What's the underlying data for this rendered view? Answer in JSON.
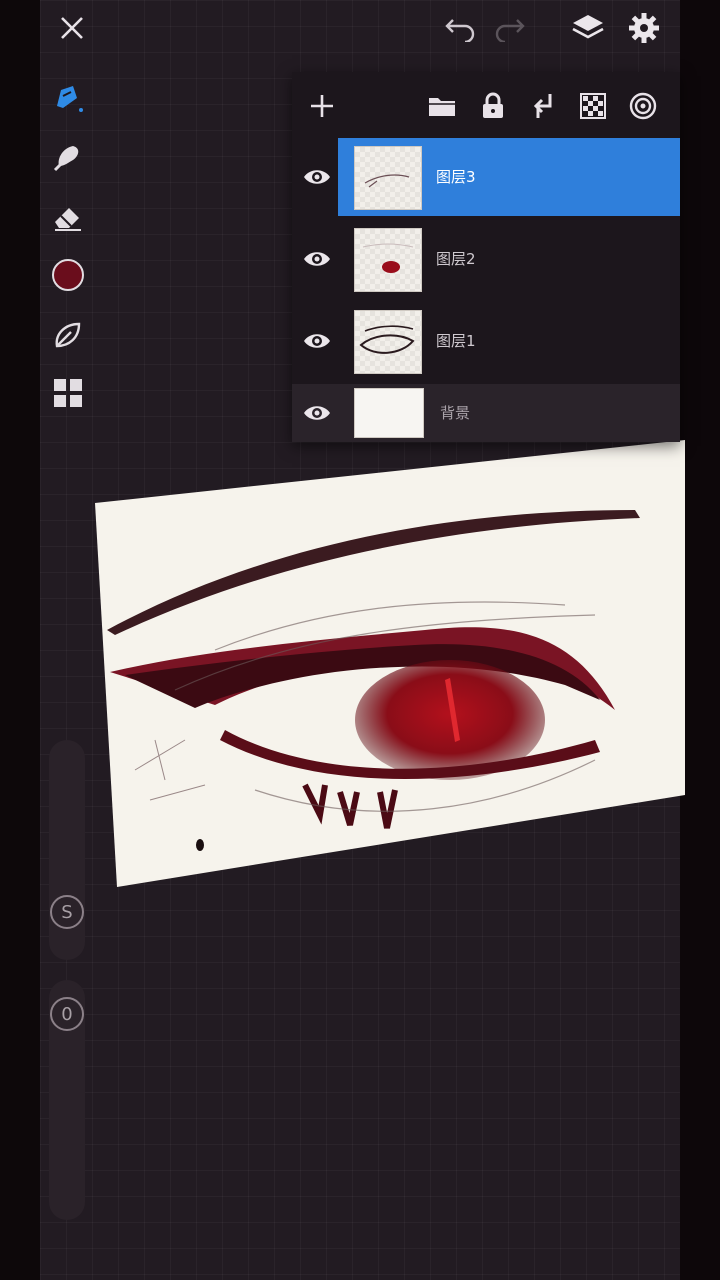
{
  "app": {
    "accent_color": "#2f7fdb",
    "current_color": "#6a0d1c"
  },
  "topbar": {
    "close_icon": "close-icon",
    "undo_icon": "undo-icon",
    "redo_icon": "redo-icon",
    "layers_icon": "layers-icon",
    "settings_icon": "gear-icon"
  },
  "toolbar": {
    "tools": [
      "pen-icon",
      "smudge-icon",
      "eraser-icon",
      "color-swatch",
      "leaf-brush-icon",
      "grid-icon"
    ]
  },
  "sliders": {
    "size_label": "S",
    "opacity_label": "0"
  },
  "layers": {
    "header_icons": [
      "add-icon",
      "folder-icon",
      "lock-icon",
      "merge-down-icon",
      "transparency-icon",
      "blend-icon"
    ],
    "items": [
      {
        "name": "图层3",
        "selected": true,
        "visible": true
      },
      {
        "name": "图层2",
        "selected": false,
        "visible": true
      },
      {
        "name": "图层1",
        "selected": false,
        "visible": true
      },
      {
        "name": "背景",
        "selected": false,
        "visible": true
      }
    ]
  }
}
